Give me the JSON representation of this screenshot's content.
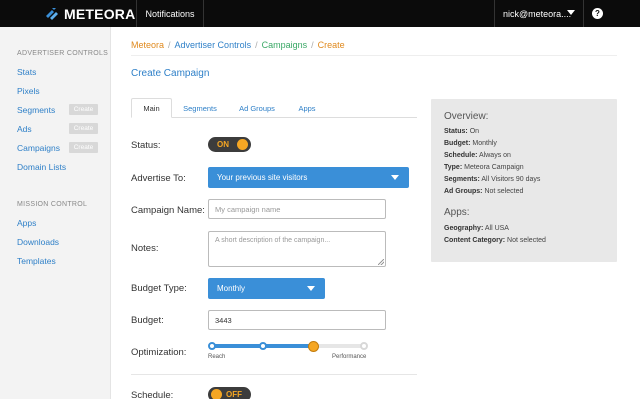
{
  "topbar": {
    "brand": "METEORA",
    "notifications_label": "Notifications",
    "user_label": "nick@meteora....",
    "help_label": "?"
  },
  "sidebar": {
    "section1_title": "ADVERTISER CONTROLS",
    "items1": [
      {
        "label": "Stats"
      },
      {
        "label": "Pixels"
      },
      {
        "label": "Segments",
        "create": "Create"
      },
      {
        "label": "Ads",
        "create": "Create"
      },
      {
        "label": "Campaigns",
        "create": "Create"
      },
      {
        "label": "Domain Lists"
      }
    ],
    "section2_title": "MISSION CONTROL",
    "items2": [
      {
        "label": "Apps"
      },
      {
        "label": "Downloads"
      },
      {
        "label": "Templates"
      }
    ]
  },
  "breadcrumb": {
    "items": [
      "Meteora",
      "Advertiser Controls",
      "Campaigns",
      "Create"
    ],
    "separator": "/"
  },
  "page_title": "Create Campaign",
  "tabs": [
    "Main",
    "Segments",
    "Ad Groups",
    "Apps"
  ],
  "form": {
    "status": {
      "label": "Status:",
      "value": "ON"
    },
    "advertise_to": {
      "label": "Advertise To:",
      "value": "Your previous site visitors"
    },
    "campaign_name": {
      "label": "Campaign Name:",
      "placeholder": "My campaign name",
      "value": ""
    },
    "notes": {
      "label": "Notes:",
      "placeholder": "A short description of the campaign...",
      "value": ""
    },
    "budget_type": {
      "label": "Budget Type:",
      "value": "Monthly"
    },
    "budget": {
      "label": "Budget:",
      "value": "3443"
    },
    "optimization": {
      "label": "Optimization:",
      "min_label": "Reach",
      "max_label": "Performance",
      "position": 2,
      "steps": 4
    },
    "schedule": {
      "label": "Schedule:",
      "value": "OFF"
    }
  },
  "overview": {
    "title": "Overview:",
    "lines": [
      {
        "key": "Status:",
        "val": "On"
      },
      {
        "key": "Budget:",
        "val": "Monthly"
      },
      {
        "key": "Schedule:",
        "val": "Always on"
      },
      {
        "key": "Type:",
        "val": "Meteora Campaign"
      },
      {
        "key": "Segments:",
        "val": "All Visitors 90 days"
      },
      {
        "key": "Ad Groups:",
        "val": "Not selected"
      }
    ],
    "apps_title": "Apps:",
    "apps_lines": [
      {
        "key": "Geography:",
        "val": "All USA"
      },
      {
        "key": "Content Category:",
        "val": "Not selected"
      }
    ]
  },
  "colors": {
    "accent_blue": "#3a8fd8",
    "link_blue": "#2f80c8",
    "orange": "#f5a623",
    "green": "#3aa866",
    "topbar": "#0b0b0b"
  }
}
